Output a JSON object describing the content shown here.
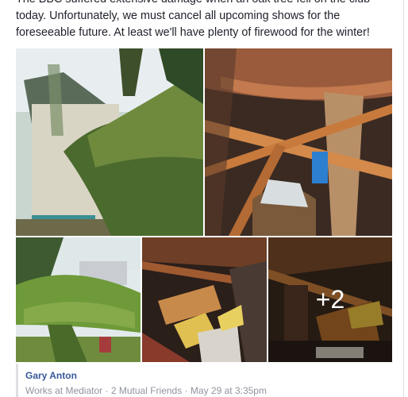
{
  "post": {
    "text": "The BBC suffered extensive damage when an oak tree fell on the club today. Unfortunately, we must cancel all upcoming shows for the foreseeable future. At least we'll have plenty of firewood for the winter!"
  },
  "photos": {
    "more_count": "+2"
  },
  "comment": {
    "author": "Gary Anton",
    "work": "Works at Mediator",
    "mutual_friends": "2 Mutual Friends",
    "timestamp": "May 29 at 3:35pm",
    "separator": "·"
  }
}
